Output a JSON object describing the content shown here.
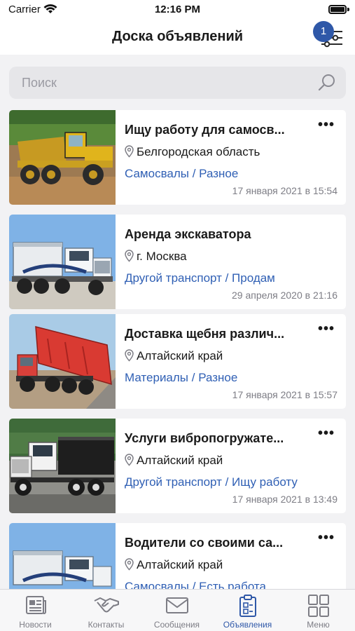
{
  "status_bar": {
    "carrier": "Carrier",
    "time": "12:16 PM"
  },
  "header": {
    "title": "Доска объявлений",
    "filter_badge": "1"
  },
  "search": {
    "placeholder": "Поиск"
  },
  "listings": [
    {
      "title": "Ищу работу для самосв...",
      "location": "Белгородская область",
      "category": "Самосвалы / Разное",
      "date": "17 января 2021 в 15:54",
      "image": "yellow-articulated-dump-truck"
    },
    {
      "title": "Аренда экскаватора",
      "location": "г. Москва",
      "category": "Другой транспорт / Продам",
      "date": "29 апреля 2020 в 21:16",
      "image": "white-dump-truck"
    },
    {
      "title": "Доставка щебня различ...",
      "location": "Алтайский край",
      "category": "Материалы / Разное",
      "date": "17 января 2021 в 15:57",
      "image": "red-tipper-dumping-gravel"
    },
    {
      "title": "Услуги вибропогружате...",
      "location": "Алтайский край",
      "category": "Другой транспорт / Ищу работу",
      "date": "17 января 2021 в 13:49",
      "image": "white-black-dump-truck"
    },
    {
      "title": "Водители со своими са...",
      "location": "Алтайский край",
      "category": "Самосвалы / Есть работа",
      "date": "",
      "image": "white-dump-truck"
    }
  ],
  "tabs": [
    {
      "label": "Новости",
      "icon": "newspaper-icon",
      "active": false
    },
    {
      "label": "Контакты",
      "icon": "handshake-icon",
      "active": false
    },
    {
      "label": "Сообщения",
      "icon": "envelope-icon",
      "active": false
    },
    {
      "label": "Объявления",
      "icon": "clipboard-icon",
      "active": true
    },
    {
      "label": "Меню",
      "icon": "grid-icon",
      "active": false
    }
  ],
  "colors": {
    "accent": "#2f58a8",
    "link": "#2f5fb4",
    "muted": "#7d7d85",
    "background": "#f2f2f4"
  }
}
